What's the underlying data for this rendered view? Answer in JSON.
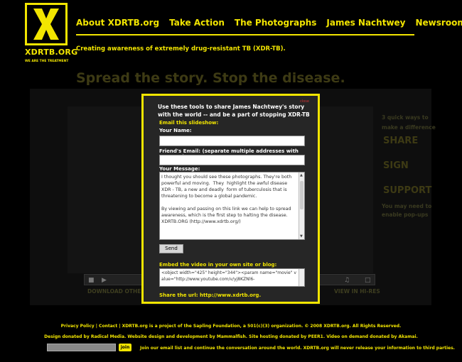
{
  "logo": {
    "name": "XDRTB.ORG",
    "tagline": "WE ARE THE TREATMENT"
  },
  "nav": {
    "items": [
      {
        "label": "About XDRTB.org"
      },
      {
        "label": "Take Action"
      },
      {
        "label": "The Photographs"
      },
      {
        "label": "James Nachtwey"
      },
      {
        "label": "Newsroom"
      }
    ]
  },
  "tagline": "Creating awareness of extremely drug-resistant TB (XDR-TB).",
  "hero": {
    "title": "Spread the story. Stop the disease.",
    "download_other": "DOWNLOAD OTHER F",
    "view_hires": "VIEW IN HI-RES"
  },
  "side": {
    "intro_line1": "3 quick ways to",
    "intro_line2": "make a difference",
    "share": "SHARE",
    "sign": "SIGN",
    "support": "SUPPORT",
    "note_line1": "You may need to",
    "note_line2": "enable pop-ups"
  },
  "modal": {
    "close": "close",
    "intro": "Use these tools to share James Nachtwey's story with the world -- and be a part of stopping XDR-TB",
    "email_heading": "Email this slideshow:",
    "your_name_label": "Your Name:",
    "your_name_value": "",
    "friend_email_label": "Friend's Email: (separate multiple addresses with commas)",
    "friend_email_value": "",
    "message_label": "Your Message:",
    "message_value": "I thought you should see these photographs. They're both powerful and moving.  They  highlight the awful disease XDR - TB, a new and deadly  form of tuberculosis that is threatening to become a global pandemic.\n\nBy viewing and passing on this link we can help to spread awareness, which is the first step to halting the disease. XDRTB.ORG (http://www.xdrtb.org/)",
    "send_label": "Send",
    "embed_heading": "Embed the video in your own site or blog:",
    "embed_value": "<object width=\"425\" height=\"344\"><param name=\"movie\" value=\"http://www.youtube.com/v/yj8KZNl6-",
    "share_url": "Share the url: http://www.xdrtb.org."
  },
  "footer": {
    "line1": "Privacy Policy | Contact | XDRTB.org is a project of the Sapling Foundation, a 501(c)(3) organization. © 2008 XDRTB.org. All Rights Reserved.",
    "line2": "Design donated by Radical Media. Website design and development by Mammalfish. Site hosting donated by PEER1. Video on demand donated by Akamai.",
    "join_label": "join",
    "join_input_value": "",
    "join_text": "Join our email list and continue the conversation around the world.  XDRTB.org will never release your information to third parties."
  },
  "colors": {
    "accent": "#f2e500",
    "background": "#000000",
    "modal_bg": "#262626"
  }
}
